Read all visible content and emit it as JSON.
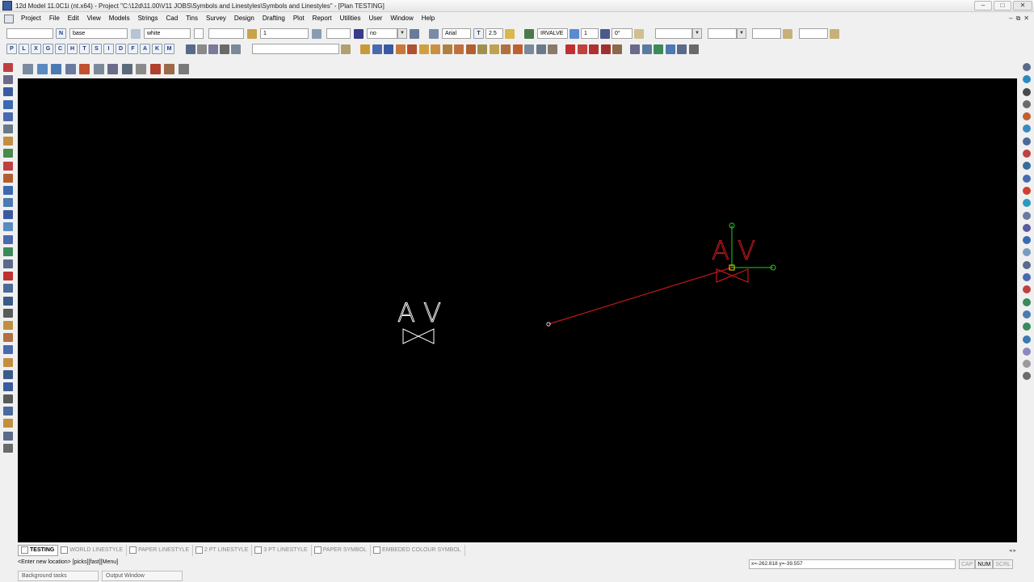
{
  "titlebar": {
    "title": "12d Model  11.0C1i (nt.x64) - Project \"C:\\12d\\11.00\\V11 JOBS\\Symbols and Linestyles\\Symbols and Linestyles\" - [Plan TESTING]",
    "minimize": "–",
    "maximize": "□",
    "close": "✕"
  },
  "menubar": {
    "items": [
      "Project",
      "File",
      "Edit",
      "View",
      "Models",
      "Strings",
      "Cad",
      "Tins",
      "Survey",
      "Design",
      "Drafting",
      "Plot",
      "Report",
      "Utilities",
      "User",
      "Window",
      "Help"
    ],
    "mdi_min": "–",
    "mdi_restore": "⧉",
    "mdi_close": "✕"
  },
  "toolbar1": {
    "name_btn": "N",
    "model": "base",
    "colour": "white",
    "weight": "1",
    "style": "no",
    "font": "Arial",
    "text_btn": "T",
    "text_size": "2.5",
    "symbol": "IRVALVE",
    "symbol_scale": "1",
    "angle": "0°"
  },
  "toolbar2": {
    "snap_buttons": [
      "P",
      "L",
      "X",
      "G",
      "C",
      "H",
      "T",
      "S",
      "I",
      "D",
      "F",
      "A",
      "K",
      "M"
    ]
  },
  "viewport": {
    "background": "#000000",
    "label_white": "A V",
    "label_red": "A V",
    "white_color": "#ffffff",
    "red_color": "#c0181c",
    "green_color": "#22cc22",
    "yellow_color": "#e6e600"
  },
  "tabs": [
    {
      "label": "TESTING",
      "active": true
    },
    {
      "label": "WORLD LINESTYLE",
      "active": false
    },
    {
      "label": "PAPER LINESTYLE",
      "active": false
    },
    {
      "label": "2 PT LINESTYLE",
      "active": false
    },
    {
      "label": "3 PT LINESTYLE",
      "active": false
    },
    {
      "label": "PAPER SYMBOL",
      "active": false
    },
    {
      "label": "EMBEDED COLOUR SYMBOL",
      "active": false
    }
  ],
  "tabs_scroll": "◂  ▸",
  "statusbar": {
    "command": "<Enter new location> [picks][fast][Menu]",
    "coords": "x=-262.818  y=-39.557",
    "cap": "CAP",
    "num": "NUM",
    "scrl": "SCRL"
  },
  "bottom_tabs": [
    "Background tasks",
    "Output Window"
  ]
}
